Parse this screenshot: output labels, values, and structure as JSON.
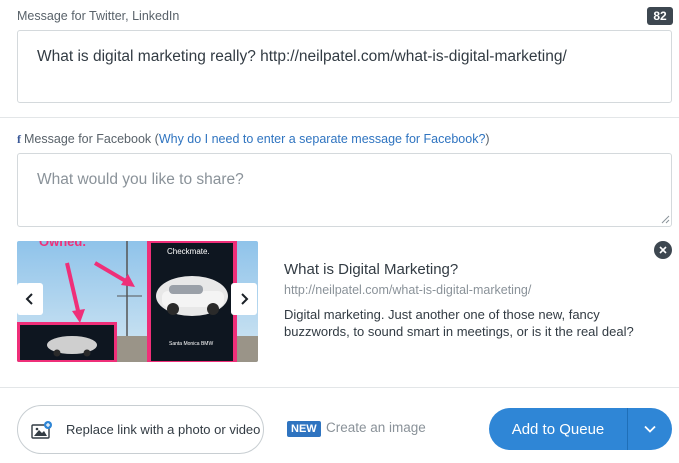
{
  "twitter": {
    "label": "Message for Twitter, LinkedIn",
    "char_count": "82",
    "message": "What is digital marketing really? http://neilpatel.com/what-is-digital-marketing/"
  },
  "facebook": {
    "icon_glyph": "f",
    "label": "Message for Facebook",
    "paren_open": "(",
    "help_link": "Why do I need to enter a separate message for Facebook?",
    "paren_close": ")",
    "placeholder": "What would you like to share?"
  },
  "preview": {
    "image_text_top": "Owned.",
    "image_text_billboard": "Checkmate.",
    "image_text_caption": "Santa Monica BMW",
    "title": "What is Digital Marketing?",
    "url": "http://neilpatel.com/what-is-digital-marketing/",
    "description": "Digital marketing. Just another one of those new, fancy buzzwords, to sound smart in meetings, or is it the real deal?"
  },
  "footer": {
    "replace_label": "Replace link with a photo or video",
    "new_badge": "NEW",
    "create_image_label": "Create an image",
    "queue_label": "Add to Queue"
  },
  "colors": {
    "primary": "#2f86d6",
    "link": "#2f74c0",
    "dark_badge": "#3d4750"
  }
}
